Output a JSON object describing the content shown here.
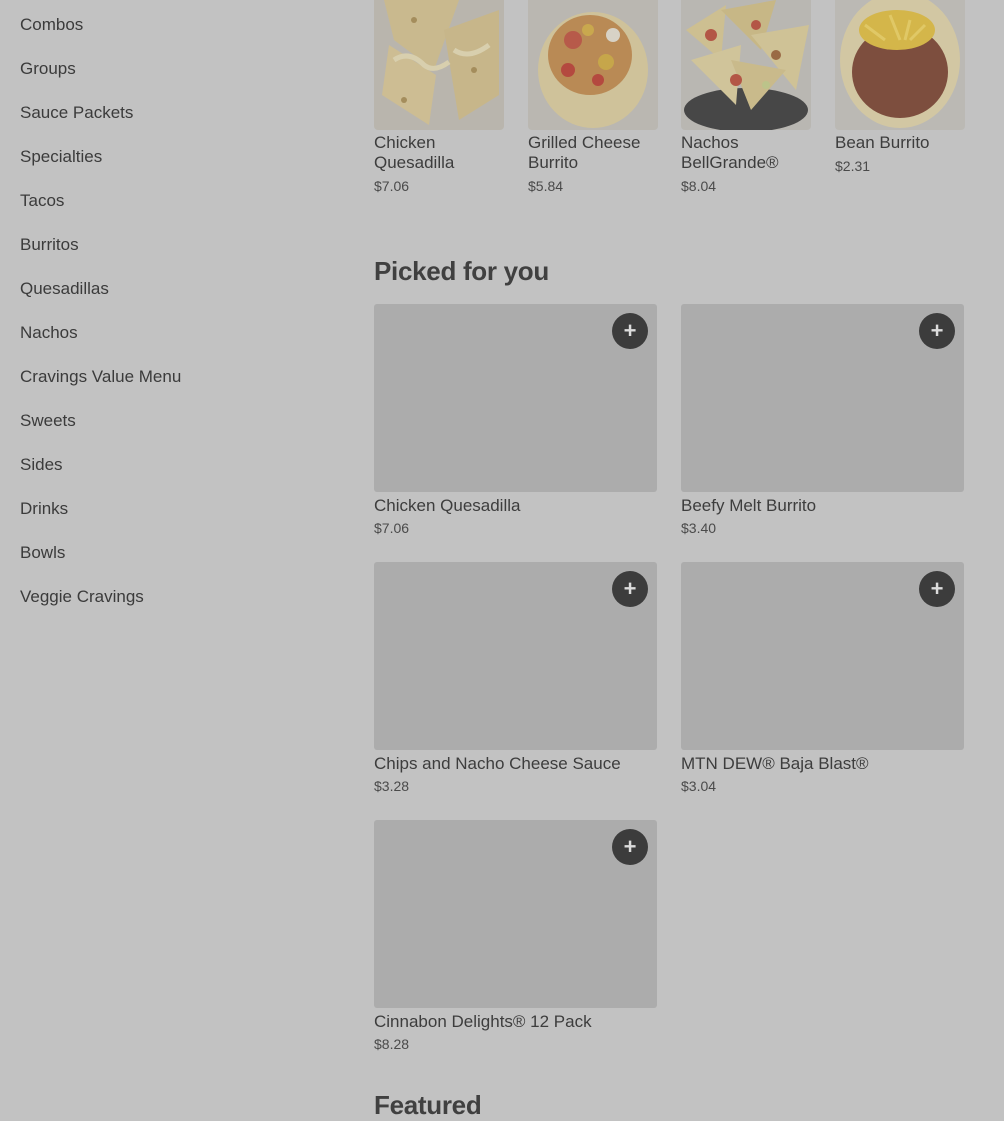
{
  "sidebar": {
    "categories": [
      "Combos",
      "Groups",
      "Sauce Packets",
      "Specialties",
      "Tacos",
      "Burritos",
      "Quesadillas",
      "Nachos",
      "Cravings Value Menu",
      "Sweets",
      "Sides",
      "Drinks",
      "Bowls",
      "Veggie Cravings"
    ]
  },
  "carousel": {
    "items": [
      {
        "name": "Chicken Quesadilla",
        "price": "$7.06",
        "image_icon": "quesadilla-image"
      },
      {
        "name": "Grilled Cheese Burrito",
        "price": "$5.84",
        "image_icon": "burrito-image"
      },
      {
        "name": "Nachos BellGrande®",
        "price": "$8.04",
        "image_icon": "nachos-image"
      },
      {
        "name": "Bean Burrito",
        "price": "$2.31",
        "image_icon": "bean-burrito-image"
      }
    ]
  },
  "picked": {
    "title": "Picked for you",
    "add_icon": "plus-icon",
    "items": [
      {
        "name": "Chicken Quesadilla",
        "price": "$7.06"
      },
      {
        "name": "Beefy Melt Burrito",
        "price": "$3.40"
      },
      {
        "name": "Chips and Nacho Cheese Sauce",
        "price": "$3.28"
      },
      {
        "name": "MTN DEW® Baja Blast®",
        "price": "$3.04"
      },
      {
        "name": "Cinnabon Delights® 12 Pack",
        "price": "$8.28"
      }
    ]
  },
  "featured": {
    "title": "Featured"
  },
  "colors": {
    "overlay_bg": "#c2c2c2",
    "placeholder": "#acacac",
    "add_button": "#3c3c3c"
  }
}
